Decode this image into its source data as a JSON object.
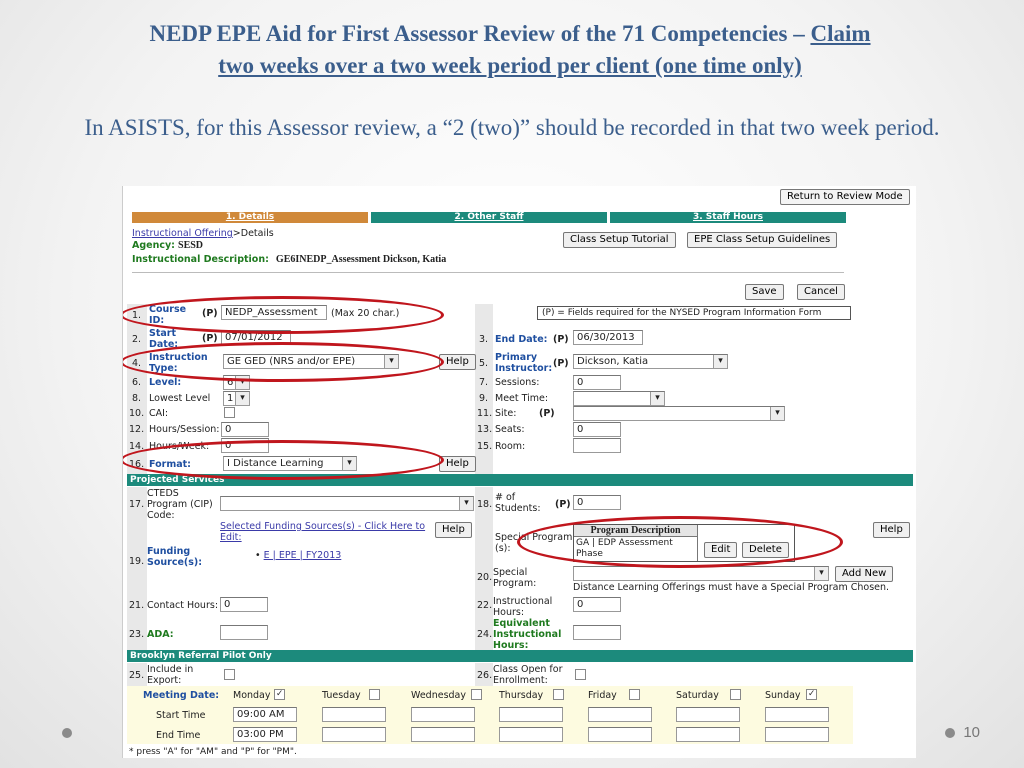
{
  "slide": {
    "title_line1": "NEDP EPE Aid for First Assessor Review of the 71 Competencies – ",
    "title_claim": "Claim",
    "title_line2": "two weeks over a two week period per client (one time only)",
    "subtitle": "In ASISTS, for this Assessor review, a “2 (two)” should be recorded in that two week period.",
    "page_number": "10"
  },
  "app": {
    "return_button": "Return to Review Mode",
    "tabs": [
      "1. Details",
      "2. Other Staff",
      "3. Staff Hours"
    ],
    "breadcrumb_link": "Instructional Offering",
    "breadcrumb_rest": ">Details",
    "agency_label": "Agency:",
    "agency_value": "SESD",
    "desc_label": "Instructional Description:",
    "desc_value": "GE6INEDP_Assessment Dickson, Katia",
    "class_setup_tutorial": "Class Setup Tutorial",
    "epe_guidelines": "EPE Class Setup Guidelines",
    "save": "Save",
    "cancel": "Cancel",
    "required_note": "(P) = Fields required for the NYSED Program Information Form",
    "help": "Help",
    "p_marker": "(P)",
    "left_fields": {
      "n1": "1.",
      "course_id_label": "Course ID:",
      "course_id_value": "NEDP_Assessment",
      "course_id_hint": "(Max 20 char.)",
      "n2": "2.",
      "start_date_label": "Start Date:",
      "start_date_value": "07/01/2012",
      "n4": "4.",
      "instruction_type_label": "Instruction Type:",
      "instruction_type_value": "GE GED (NRS and/or EPE)",
      "n6": "6.",
      "level_label": "Level:",
      "level_value": "6",
      "n8": "8.",
      "lowest_level_label": "Lowest Level",
      "lowest_level_value": "1",
      "n10": "10.",
      "cai_label": "CAI:",
      "n12": "12.",
      "hours_session_label": "Hours/Session:",
      "hours_session_value": "0",
      "n14": "14.",
      "hours_week_label": "Hours/Week:",
      "hours_week_value": "0",
      "n16": "16.",
      "format_label": "Format:",
      "format_value": "I Distance Learning"
    },
    "right_fields": {
      "n3": "3.",
      "end_date_label": "End Date:",
      "end_date_value": "06/30/2013",
      "n5": "5.",
      "primary_instructor_label": "Primary Instructor:",
      "primary_instructor_value": "Dickson, Katia",
      "n7": "7.",
      "sessions_label": "Sessions:",
      "sessions_value": "0",
      "n9": "9.",
      "meet_time_label": "Meet Time:",
      "n11": "11.",
      "site_label": "Site:",
      "n13": "13.",
      "seats_label": "Seats:",
      "seats_value": "0",
      "n15": "15.",
      "room_label": "Room:"
    },
    "projected_services": {
      "header": "Projected Services",
      "n17": "17.",
      "cteds_label": "CTEDS Program (CIP) Code:",
      "n18": "18.",
      "students_label": "# of Students:",
      "students_value": "0",
      "funding_link": "Selected Funding Sources(s) - Click Here to Edit:",
      "n19": "19.",
      "funding_label": "Funding Source(s):",
      "funding_item": "E | EPE | FY2013",
      "special_program_s_label": "Special Program (s):",
      "pd_header": "Program Description",
      "pd_value": "GA | EDP Assessment Phase",
      "edit": "Edit",
      "delete": "Delete",
      "n20": "20.",
      "special_program_label": "Special Program:",
      "add_new": "Add New",
      "dl_note": "Distance Learning Offerings must have a Special Program Chosen.",
      "n21": "21.",
      "contact_hours_label": "Contact Hours:",
      "contact_hours_value": "0",
      "n22": "22.",
      "instr_hours_label": "Instructional Hours:",
      "instr_hours_value": "0",
      "n23": "23.",
      "ada_label": "ADA:",
      "n24": "24.",
      "equiv_label": "Equivalent Instructional Hours:"
    },
    "brooklyn": {
      "header": "Brooklyn Referral Pilot Only",
      "n25": "25.",
      "include_label": "Include in Export:",
      "n26": "26.",
      "class_open_label": "Class Open for Enrollment:"
    },
    "meeting": {
      "label": "Meeting Date:",
      "days": [
        "Monday",
        "Tuesday",
        "Wednesday",
        "Thursday",
        "Friday",
        "Saturday",
        "Sunday"
      ],
      "checked": [
        true,
        false,
        false,
        false,
        false,
        false,
        true
      ],
      "start_label": "Start Time",
      "end_label": "End Time",
      "start_monday": "09:00 AM",
      "end_monday": "03:00 PM",
      "footnote": "* press \"A\" for \"AM\" and \"P\" for \"PM\"."
    }
  },
  "colors": {
    "title": "#3b5e8c",
    "tab_details": "#d0893a",
    "tab_other": "#1c8a7c",
    "section_bar": "#1c8a7c",
    "ellipse": "#c0161d"
  }
}
